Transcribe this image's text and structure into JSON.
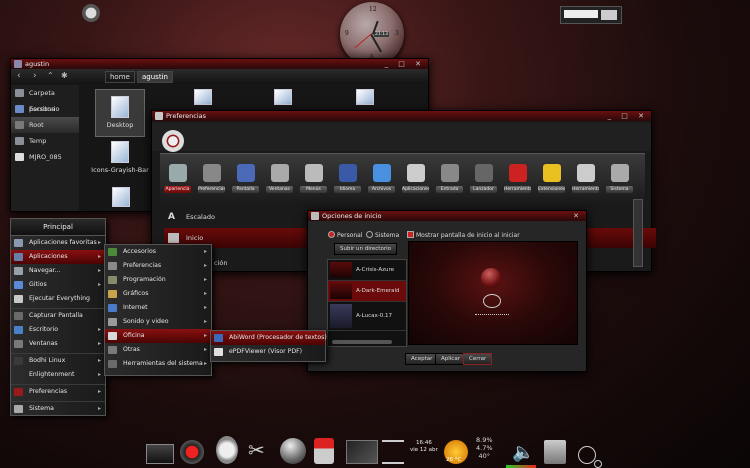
{
  "desktop": {
    "clock_numbers": [
      "12",
      "3",
      "6",
      "9"
    ],
    "clock_readout": "21:13"
  },
  "file_manager": {
    "title": "agustin",
    "path": [
      "home",
      "agustin"
    ],
    "sidebar": [
      {
        "label": "Carpeta persona",
        "icon": "home-folder-icon"
      },
      {
        "label": "Escritorio",
        "icon": "desktop-icon"
      },
      {
        "label": "Root",
        "icon": "drive-icon"
      },
      {
        "label": "Temp",
        "icon": "folder-icon"
      },
      {
        "label": "MJRO_085",
        "icon": "usb-drive-icon"
      }
    ],
    "items": [
      {
        "label": "Desktop"
      },
      {
        "label": "Icons-Grayish-Bar"
      }
    ]
  },
  "preferences": {
    "title": "Preferencias",
    "tabs": [
      "Apariencia",
      "Preferencias",
      "Pantalla",
      "Ventanas",
      "Menús",
      "Idioma",
      "Archivos",
      "Aplicaciones",
      "Entrada",
      "Lanzador",
      "Herramientas",
      "Extensiones",
      "Herramientas",
      "Sistema"
    ],
    "rows": [
      "Escalado",
      "Inicio",
      "ción"
    ]
  },
  "start_dialog": {
    "title": "Opciones de inicio",
    "radio_personal": "Personal",
    "radio_system": "Sistema",
    "check_label": "Mostrar pantalla de inicio al iniciar",
    "upload_button": "Subir un directorio",
    "themes": [
      "A-Crisis-Azure",
      "A-Dark-Emerald",
      "A-Lucax-0.17"
    ],
    "accept": "Aceptar",
    "apply": "Aplicar",
    "close": "Cerrar"
  },
  "main_menu": {
    "title": "Principal",
    "items": [
      {
        "label": "Aplicaciones favoritas",
        "arrow": true,
        "icon_color": "#8a98b0"
      },
      {
        "label": "Aplicaciones",
        "arrow": true,
        "icon_color": "#6a7fa6",
        "selected": true
      },
      {
        "label": "Navegar...",
        "arrow": true,
        "icon_color": "#9aa0a8"
      },
      {
        "label": "Gitios",
        "arrow": true,
        "icon_color": "#5a8ad6"
      },
      {
        "label": "Ejecutar Everything",
        "arrow": false,
        "icon_color": "#c9c9c9"
      },
      {
        "label": "Capturar Pantalla",
        "arrow": false,
        "icon_color": "#6a6a6a",
        "group": true
      },
      {
        "label": "Escritorio",
        "arrow": true,
        "icon_color": "#4a80c8"
      },
      {
        "label": "Ventanas",
        "arrow": true,
        "icon_color": "#7a7a7a"
      },
      {
        "label": "Bodhi Linux",
        "arrow": true,
        "icon_color": "#3a3a3a",
        "group": true
      },
      {
        "label": "Enlightenment",
        "arrow": true,
        "icon_color": "#2a2a2a"
      },
      {
        "label": "Preferencias",
        "arrow": true,
        "icon_color": "#9a1a1a",
        "group": true
      },
      {
        "label": "Sistema",
        "arrow": true,
        "icon_color": "#aaaaaa",
        "group": true
      }
    ]
  },
  "apps_menu": {
    "items": [
      {
        "label": "Accesorios",
        "icon_color": "#4a8a3a"
      },
      {
        "label": "Preferencias",
        "icon_color": "#8a8a8a"
      },
      {
        "label": "Programación",
        "icon_color": "#8a8a6a"
      },
      {
        "label": "Gráficos",
        "icon_color": "#c9a24a"
      },
      {
        "label": "Internet",
        "icon_color": "#4a7ac8"
      },
      {
        "label": "Sonido y video",
        "icon_color": "#9a9a9a"
      },
      {
        "label": "Oficina",
        "icon_color": "#d8d8d8",
        "selected": true
      },
      {
        "label": "Otras",
        "icon_color": "#7a7a7a"
      },
      {
        "label": "Herramientas del sistema",
        "icon_color": "#6a6a6a"
      }
    ]
  },
  "office_menu": {
    "items": [
      {
        "label": "AbiWord (Procesador de textos)",
        "icon_color": "#3a6ab8",
        "selected": true
      },
      {
        "label": "ePDFViewer (Visor PDF)",
        "icon_color": "#e0e0e0"
      }
    ]
  },
  "dock": {
    "time": "16:46",
    "date": "vie 12 abr",
    "temp": "26 °C",
    "stats": [
      "8.9%",
      "4.7%",
      "40°"
    ]
  }
}
